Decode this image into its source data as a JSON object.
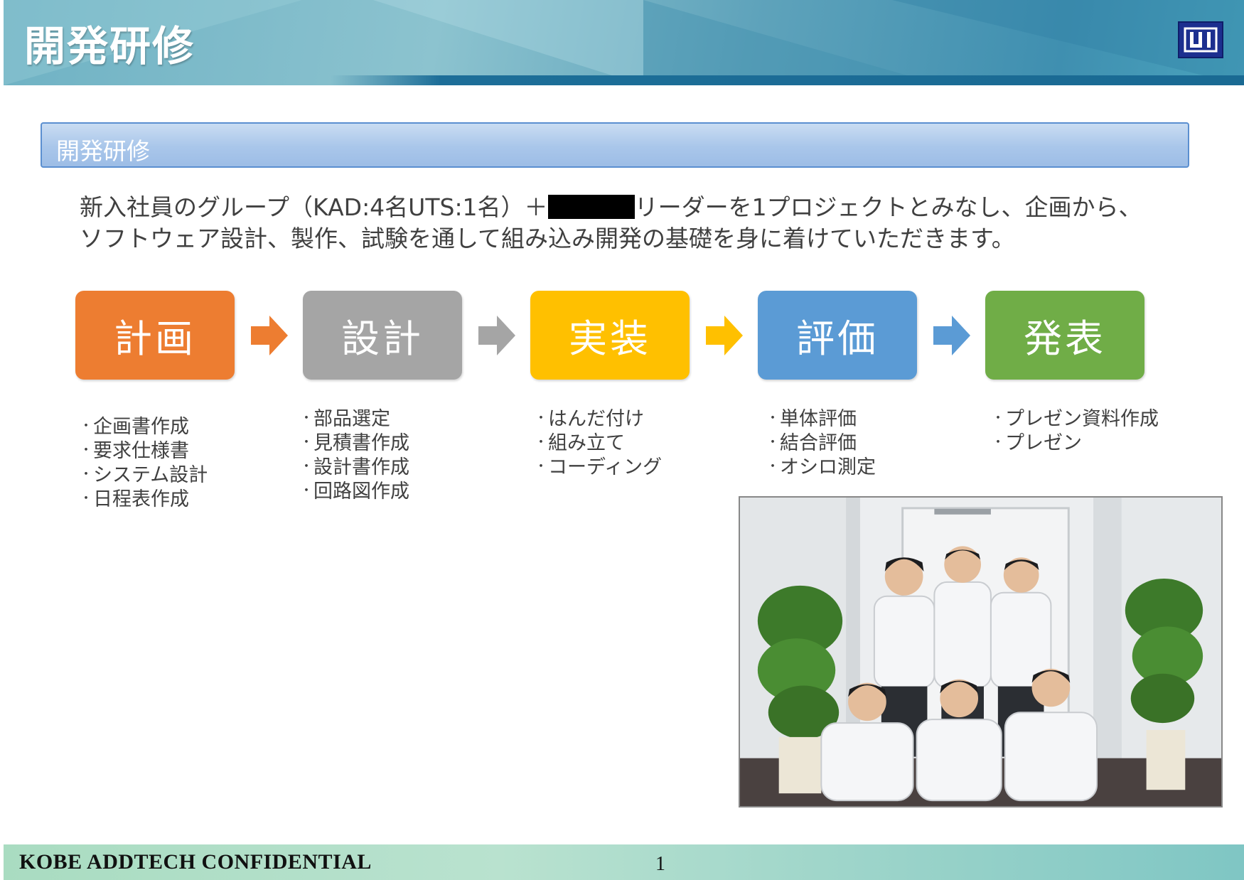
{
  "header": {
    "title": "開発研修",
    "logo_icon": "company-logo-icon",
    "colors": {
      "banner": "#5fa3bb",
      "band": "#1d6e98",
      "logo": "#1c2f8f"
    }
  },
  "section": {
    "heading": "開発研修",
    "color": "#a9c6ea"
  },
  "description": {
    "line1_before": "新入社員のグループ（KAD:4名UTS:1名）＋",
    "line1_after": "リーダーを1プロジェクトとみなし、企画から、",
    "line2": "ソフトウェア設計、製作、試験を通して組み込み開発の基礎を身に着けていただきます。"
  },
  "steps": [
    {
      "label": "計画",
      "color": "#ed7d31",
      "items": [
        "企画書作成",
        "要求仕様書",
        "システム設計",
        "日程表作成"
      ]
    },
    {
      "label": "設計",
      "color": "#a5a5a5",
      "items": [
        "部品選定",
        "見積書作成",
        "設計書作成",
        "回路図作成"
      ]
    },
    {
      "label": "実装",
      "color": "#ffc000",
      "items": [
        "はんだ付け",
        "組み立て",
        "コーディング"
      ]
    },
    {
      "label": "評価",
      "color": "#5b9bd5",
      "items": [
        "単体評価",
        "結合評価",
        "オシロ測定"
      ]
    },
    {
      "label": "発表",
      "color": "#70ad47",
      "items": [
        "プレゼン資料作成",
        "プレゼン"
      ]
    }
  ],
  "arrows": [
    {
      "icon": "arrow-right-icon",
      "color": "#ed7d31"
    },
    {
      "icon": "arrow-right-icon",
      "color": "#a5a5a5"
    },
    {
      "icon": "arrow-right-icon",
      "color": "#ffc000"
    },
    {
      "icon": "arrow-right-icon",
      "color": "#5b9bd5"
    }
  ],
  "photo": {
    "subject": "group-photo"
  },
  "footer": {
    "text": "KOBE ADDTECH CONFIDENTIAL",
    "page_number": "1"
  }
}
